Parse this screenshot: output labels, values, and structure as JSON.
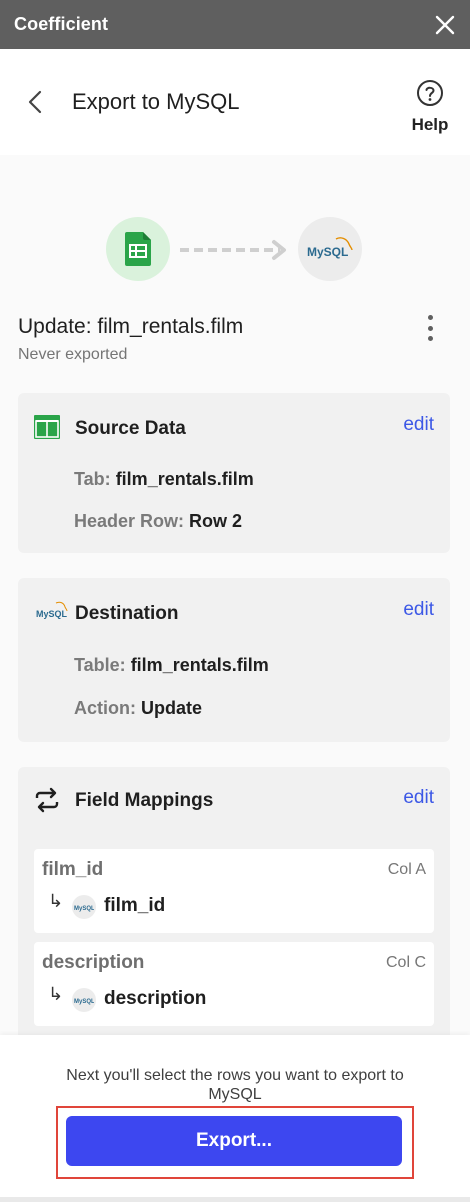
{
  "app": {
    "title": "Coefficient"
  },
  "header": {
    "title": "Export to MySQL",
    "help_label": "Help"
  },
  "flow": {
    "source_icon": "google-sheets-icon",
    "target_icon": "mysql-logo",
    "target_text": "MySQL"
  },
  "export": {
    "title": "Update: film_rentals.film",
    "status": "Never exported"
  },
  "source_card": {
    "title": "Source Data",
    "edit_label": "edit",
    "fields": [
      {
        "key": "Tab:",
        "value": "film_rentals.film"
      },
      {
        "key": "Header Row:",
        "value": "Row 2"
      }
    ]
  },
  "destination_card": {
    "title": "Destination",
    "edit_label": "edit",
    "fields": [
      {
        "key": "Table:",
        "value": "film_rentals.film"
      },
      {
        "key": "Action:",
        "value": "Update"
      }
    ]
  },
  "mappings_card": {
    "title": "Field Mappings",
    "edit_label": "edit",
    "items": [
      {
        "source": "film_id",
        "column": "Col A",
        "target": "film_id"
      },
      {
        "source": "description",
        "column": "Col C",
        "target": "description"
      }
    ]
  },
  "footer": {
    "hint": "Next you'll select the rows you want to export to MySQL",
    "export_label": "Export..."
  },
  "colors": {
    "accent": "#3d47f0",
    "link": "#3c58e6",
    "highlight": "#e0453a",
    "titlebar": "#5f5f5f"
  }
}
